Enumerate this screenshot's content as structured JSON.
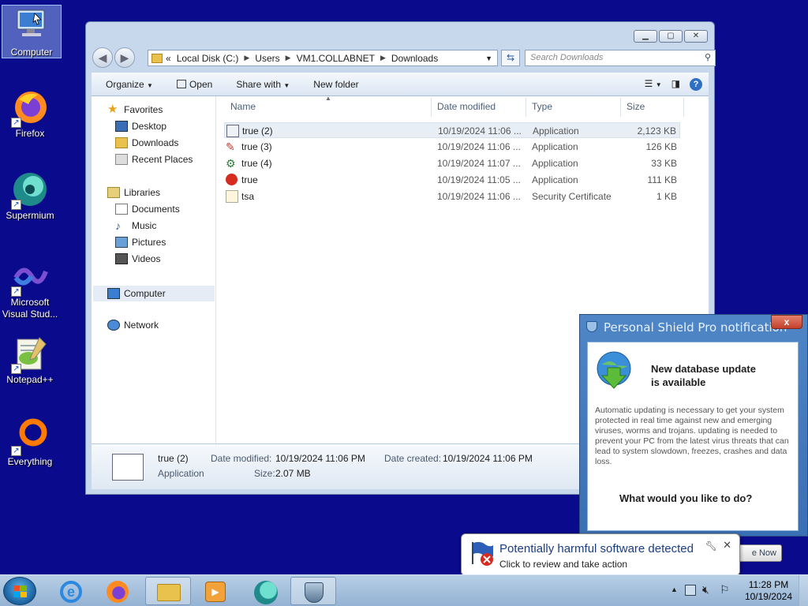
{
  "desktop": {
    "icons": [
      {
        "label": "Computer"
      },
      {
        "label": "Firefox"
      },
      {
        "label": "Supermium"
      },
      {
        "label": "Microsoft Visual Stud..."
      },
      {
        "label": "Notepad++"
      },
      {
        "label": "Everything"
      }
    ]
  },
  "explorer": {
    "breadcrumb": {
      "overflow": "«",
      "segments": [
        "Local Disk (C:)",
        "Users",
        "VM1.COLLABNET",
        "Downloads"
      ]
    },
    "search_placeholder": "Search Downloads",
    "toolbar": {
      "organize": "Organize",
      "open": "Open",
      "share_with": "Share with",
      "new_folder": "New folder"
    },
    "nav": {
      "favorites": "Favorites",
      "desktop": "Desktop",
      "downloads": "Downloads",
      "recent_places": "Recent Places",
      "libraries": "Libraries",
      "documents": "Documents",
      "music": "Music",
      "pictures": "Pictures",
      "videos": "Videos",
      "computer": "Computer",
      "network": "Network"
    },
    "columns": {
      "name": "Name",
      "date": "Date modified",
      "type": "Type",
      "size": "Size"
    },
    "files": [
      {
        "name": "true (2)",
        "date": "10/19/2024 11:06 ...",
        "type": "Application",
        "size": "2,123 KB"
      },
      {
        "name": "true (3)",
        "date": "10/19/2024 11:06 ...",
        "type": "Application",
        "size": "126 KB"
      },
      {
        "name": "true (4)",
        "date": "10/19/2024 11:07 ...",
        "type": "Application",
        "size": "33 KB"
      },
      {
        "name": "true",
        "date": "10/19/2024 11:05 ...",
        "type": "Application",
        "size": "111 KB"
      },
      {
        "name": "tsa",
        "date": "10/19/2024 11:06 ...",
        "type": "Security Certificate",
        "size": "1 KB"
      }
    ],
    "details": {
      "name": "true (2)",
      "type": "Application",
      "modified_label": "Date modified:",
      "modified": "10/19/2024 11:06 PM",
      "created_label": "Date created:",
      "created": "10/19/2024 11:06 PM",
      "size_label": "Size:",
      "size": "2.07 MB"
    }
  },
  "popup": {
    "title": "Personal Shield Pro notification",
    "close": "x",
    "heading_line1": "New database update",
    "heading_line2": "is available",
    "body": "Automatic updating is necessary to get your system protected in real time against new and emerging viruses, worms and trojans. updating is needed to prevent your PC from the latest virus threats that can lead to system slowdown, freezes, crashes and data loss.",
    "question": "What would you like to do?",
    "button": "e Now"
  },
  "balloon": {
    "title": "Potentially harmful software detected",
    "text": "Click to review and take action",
    "close": "✕"
  },
  "taskbar": {
    "time": "11:28 PM",
    "date": "10/19/2024"
  },
  "colors": {
    "desktop_bg": "#0a0a8c",
    "accent": "#3a6fb3"
  }
}
